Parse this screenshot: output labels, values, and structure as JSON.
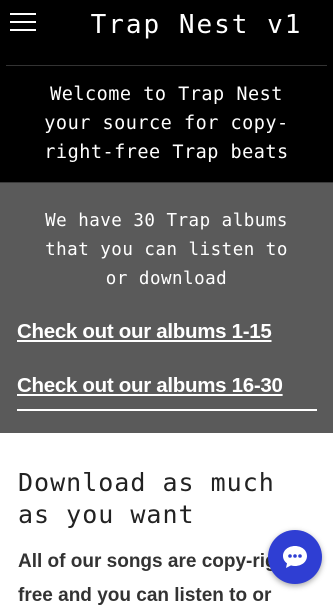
{
  "header": {
    "title": "Trap Nest v1",
    "menu_icon": "hamburger-menu-icon",
    "welcome_lines": [
      "Welcome to Trap Nest",
      "your source for copy-",
      "right-free Trap beats"
    ]
  },
  "albums": {
    "text_lines": [
      "We have 30 Trap albums",
      "that you can listen to",
      "or download"
    ],
    "link_1": "Check out our albums 1-15",
    "link_2": "Check out our albums 16-30"
  },
  "section": {
    "heading_lines": [
      "Download as much",
      "as you want"
    ],
    "body_lines": [
      "All of our songs are copy-right-",
      "free and you can listen to or"
    ]
  },
  "chat": {
    "icon": "chat-bubble-icon",
    "color": "#2f3ed3"
  },
  "colors": {
    "header_bg": "#000000",
    "albums_bg": "#5a5a5a",
    "page_bg": "#ffffff"
  }
}
